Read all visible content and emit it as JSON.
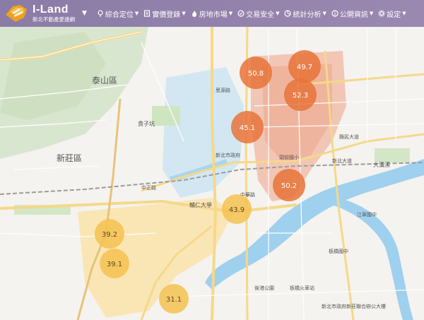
{
  "brand": {
    "name": "I-Land",
    "tagline": "新北不動產愛連網"
  },
  "nav": [
    {
      "label": "綜合定位",
      "icon": "map-pin-icon",
      "name": "nav-location"
    },
    {
      "label": "實價登錄",
      "icon": "document-icon",
      "name": "nav-price-registry"
    },
    {
      "label": "房地市場",
      "icon": "fire-icon",
      "name": "nav-market"
    },
    {
      "label": "交易安全",
      "icon": "check-circle-icon",
      "name": "nav-safety"
    },
    {
      "label": "統計分析",
      "icon": "chart-icon",
      "name": "nav-stats"
    },
    {
      "label": "公開資訊",
      "icon": "info-icon",
      "name": "nav-public-info"
    },
    {
      "label": "設定",
      "icon": "gear-icon",
      "name": "nav-settings"
    }
  ],
  "clusters": [
    {
      "value": "50.8",
      "color": "#e8733a"
    },
    {
      "value": "49.7",
      "color": "#e8733a"
    },
    {
      "value": "52.3",
      "color": "#e8733a"
    },
    {
      "value": "45.1",
      "color": "#e8733a"
    },
    {
      "value": "50.2",
      "color": "#e8733a"
    },
    {
      "value": "43.9",
      "color": "#f6c150"
    },
    {
      "value": "39.2",
      "color": "#f6c150"
    },
    {
      "value": "39.1",
      "color": "#f6c150"
    },
    {
      "value": "31.1",
      "color": "#f6c150"
    }
  ],
  "districts": [
    "泰山區",
    "新莊區"
  ],
  "places": [
    "貴子坑",
    "輔仁大學",
    "新北市政府",
    "大漢溪",
    "江翠國中",
    "板橋火車站",
    "頭前國小",
    "板橋國中",
    "後港公園",
    "新北市政府新莊聯合辦公大樓"
  ],
  "roads": [
    "中正路",
    "思源路",
    "新北大道",
    "中華路",
    "縣民大道"
  ]
}
